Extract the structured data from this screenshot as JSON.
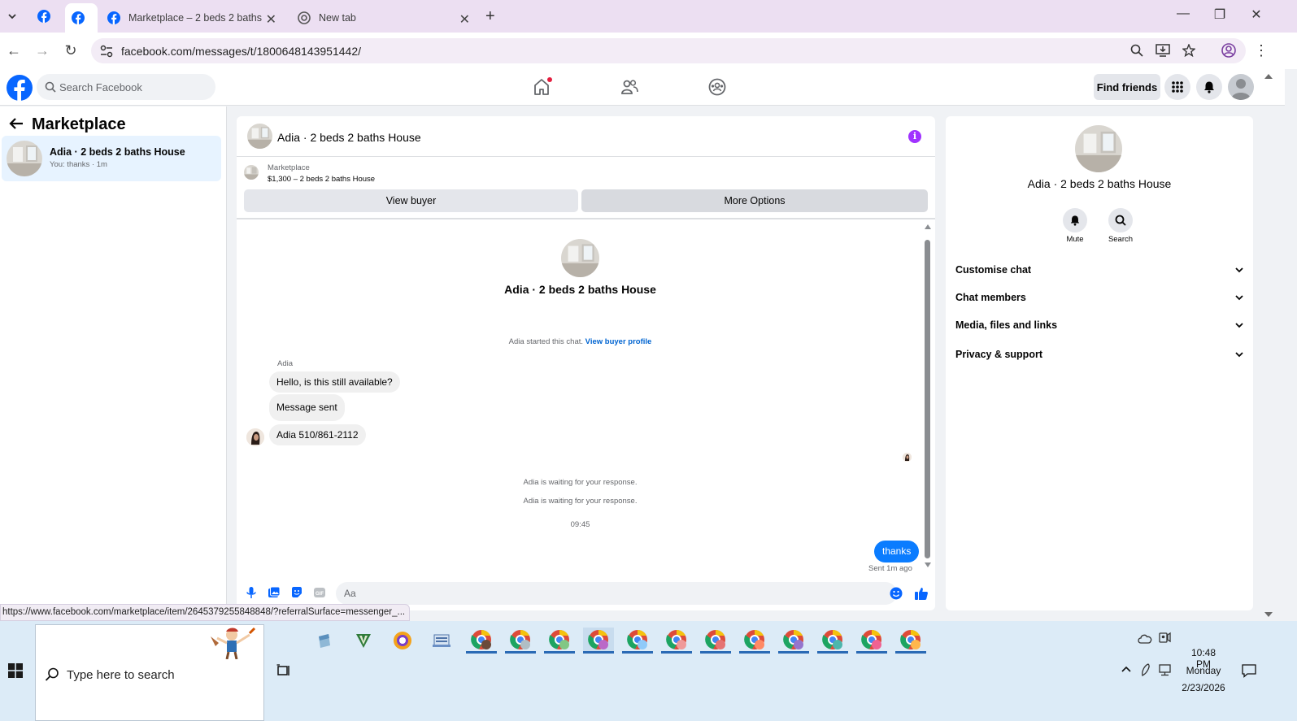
{
  "browser": {
    "tabs": [
      {
        "title": "Marketplace – 2 beds 2 baths House",
        "active": false
      },
      {
        "title": "New tab",
        "active": false
      }
    ],
    "url": "facebook.com/messages/t/1800648143951442/",
    "status_url": "https://www.facebook.com/marketplace/item/2645379255848848/?referralSurface=messenger_..."
  },
  "fb_header": {
    "search_placeholder": "Search Facebook",
    "find_friends_label": "Find friends"
  },
  "sidebar": {
    "title": "Marketplace",
    "conversations": [
      {
        "name": "Adia · 2 beds 2 baths House",
        "preview": "You: thanks · 1m"
      }
    ]
  },
  "chat": {
    "title": "Adia · 2 beds 2 baths House",
    "marketplace_label": "Marketplace",
    "listing": "$1,300 – 2 beds 2 baths House",
    "view_buyer_label": "View buyer",
    "more_options_label": "More Options",
    "center_name": "Adia · 2 beds 2 baths House",
    "started_text": "Adia started this chat.",
    "view_buyer_profile_link": "View buyer profile",
    "sender": "Adia",
    "incoming": [
      "Hello, is this still available?",
      "Message sent",
      "Adia 510/861-2112"
    ],
    "waiting_notices": [
      "Adia is waiting for your response.",
      "Adia is waiting for your response."
    ],
    "timestamp": "09:45",
    "outgoing": "thanks",
    "sent_status": "Sent 1m ago",
    "composer_placeholder": "Aa"
  },
  "details_panel": {
    "name": "Adia · 2 beds 2 baths House",
    "actions": [
      {
        "label": "Mute",
        "icon": "bell-icon"
      },
      {
        "label": "Search",
        "icon": "search-icon"
      }
    ],
    "sections": [
      "Customise chat",
      "Chat members",
      "Media, files and links",
      "Privacy & support"
    ]
  },
  "taskbar": {
    "search_placeholder": "Type here to search",
    "time": "10:48 PM",
    "day": "Monday",
    "date": "2/23/2026"
  },
  "colors": {
    "fb_blue": "#0866ff",
    "messenger_bubble": "#0a7cff",
    "info_purple": "#a033ff"
  }
}
